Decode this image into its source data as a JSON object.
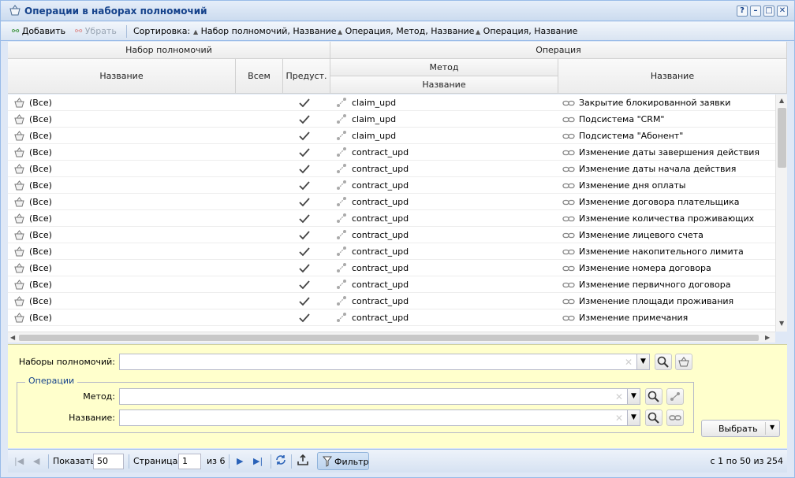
{
  "window": {
    "title": "Операции в наборах полномочий",
    "controls": [
      "?",
      "–",
      "□",
      "✕"
    ]
  },
  "toolbar": {
    "add_label": "Добавить",
    "remove_label": "Убрать",
    "sort_label": "Сортировка:",
    "sort1": "Набор полномочий, Название",
    "sort2": "Операция, Метод, Название",
    "sort3": "Операция, Название"
  },
  "grid": {
    "headers": {
      "group_set": "Набор полномочий",
      "group_op": "Операция",
      "name": "Название",
      "all": "Всем",
      "provided": "Предуст.",
      "method": "Метод",
      "method_name": "Название",
      "op_name": "Название"
    },
    "rows": [
      {
        "set": "(Все)",
        "method": "claim_upd",
        "operation": "Закрытие блокированной заявки"
      },
      {
        "set": "(Все)",
        "method": "claim_upd",
        "operation": "Подсистема \"CRM\""
      },
      {
        "set": "(Все)",
        "method": "claim_upd",
        "operation": "Подсистема \"Абонент\""
      },
      {
        "set": "(Все)",
        "method": "contract_upd",
        "operation": "Изменение даты завершения действия"
      },
      {
        "set": "(Все)",
        "method": "contract_upd",
        "operation": "Изменение даты начала действия"
      },
      {
        "set": "(Все)",
        "method": "contract_upd",
        "operation": "Изменение дня оплаты"
      },
      {
        "set": "(Все)",
        "method": "contract_upd",
        "operation": "Изменение договора плательщика"
      },
      {
        "set": "(Все)",
        "method": "contract_upd",
        "operation": "Изменение количества проживающих"
      },
      {
        "set": "(Все)",
        "method": "contract_upd",
        "operation": "Изменение лицевого счета"
      },
      {
        "set": "(Все)",
        "method": "contract_upd",
        "operation": "Изменение накопительного лимита"
      },
      {
        "set": "(Все)",
        "method": "contract_upd",
        "operation": "Изменение номера договора"
      },
      {
        "set": "(Все)",
        "method": "contract_upd",
        "operation": "Изменение первичного договора"
      },
      {
        "set": "(Все)",
        "method": "contract_upd",
        "operation": "Изменение площади проживания"
      },
      {
        "set": "(Все)",
        "method": "contract_upd",
        "operation": "Изменение примечания"
      }
    ]
  },
  "filter": {
    "permission_sets_label": "Наборы полномочий:",
    "operations_legend": "Операции",
    "method_label": "Метод:",
    "name_label": "Название:",
    "select_label": "Выбрать",
    "permission_sets_value": "",
    "method_value": "",
    "name_value": ""
  },
  "pager": {
    "show_label": "Показать",
    "page_size": "50",
    "page_label": "Страница",
    "page": "1",
    "of_label": "из 6",
    "filter_label": "Фильтр",
    "summary": "с 1 по 50 из 254"
  }
}
